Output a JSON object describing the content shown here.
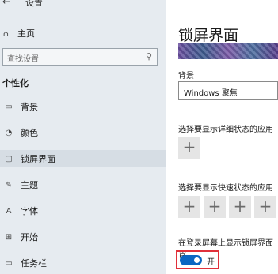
{
  "window": {
    "back_glyph": "←",
    "title": "设置"
  },
  "sidebar": {
    "home_label": "主页",
    "search_placeholder": "查找设置",
    "section_title": "个性化",
    "items": [
      {
        "label": "背景",
        "icon": "picture-icon"
      },
      {
        "label": "颜色",
        "icon": "palette-icon"
      },
      {
        "label": "锁屏界面",
        "icon": "lock-screen-icon"
      },
      {
        "label": "主题",
        "icon": "brush-icon"
      },
      {
        "label": "字体",
        "icon": "font-icon"
      },
      {
        "label": "开始",
        "icon": "start-icon"
      },
      {
        "label": "任务栏",
        "icon": "taskbar-icon"
      }
    ],
    "active_item": "锁屏界面"
  },
  "main": {
    "title": "锁屏界面",
    "background_label": "背景",
    "background_value": "Windows 聚焦",
    "detailed_status_label": "选择要显示详细状态的应用",
    "quick_status_label": "选择要显示快速状态的应用",
    "plus_glyph": "+",
    "login_label": "在登录屏幕上显示锁屏界面背",
    "toggle_state": "开"
  },
  "colors": {
    "accent": "#0a66c2",
    "highlight": "#e0303a",
    "sidebar_bg": "#e6ebf0"
  }
}
